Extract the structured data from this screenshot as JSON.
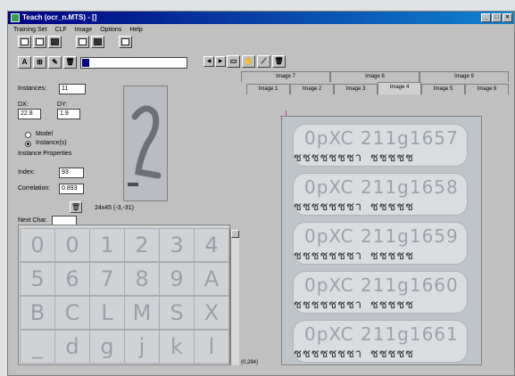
{
  "window": {
    "title": "Teach (ocr_n.MTS) - []"
  },
  "menu": [
    "Training Set",
    "CLF",
    "Image",
    "Options",
    "Help"
  ],
  "left": {
    "instances_label": "Instances:",
    "instances_value": "11",
    "dx_label": "DX:",
    "dx_value": "22.8",
    "dy_label": "DY:",
    "dy_value": "1.9",
    "radio_model": "Model",
    "radio_instances": "Instance(s)",
    "props_label": "Instance Properties",
    "index_label": "Index:",
    "index_value": "93",
    "corr_label": "Correlation:",
    "corr_value": "0.893",
    "size_text": "24x45 (-3,-31)",
    "next_char_label": "Next Char."
  },
  "grid_chars": [
    "0",
    "0",
    "1",
    "2",
    "3",
    "4",
    "5",
    "6",
    "7",
    "8",
    "9",
    "A",
    "B",
    "C",
    "L",
    "M",
    "S",
    "X",
    "_",
    "d",
    "g",
    "j",
    "k",
    "l"
  ],
  "tabs_top": [
    "Image 7",
    "Image 8",
    "Image 9"
  ],
  "tabs_bottom": [
    "Image 1",
    "Image 2",
    "Image 3",
    "Image 4",
    "Image 5",
    "Image 6"
  ],
  "plates": [
    {
      "top": "0pXC 211g1657",
      "bot": "ชชชชชชชา ชชชชช"
    },
    {
      "top": "0pXC 211g1658",
      "bot": "ชชชชชชชา ชชชชช"
    },
    {
      "top": "0pXC 211g1659",
      "bot": "ชชชชชชชา ชชชชช"
    },
    {
      "top": "0pXC 211g1660",
      "bot": "ชชชชชชชา ชชชชช"
    },
    {
      "top": "0pXC 211g1661",
      "bot": "ชชชชชชชา ชชชชช"
    }
  ],
  "coords": "(0,284)",
  "icons": {
    "minimize": "minimize-icon",
    "restore": "restore-icon",
    "close": "close-icon"
  }
}
